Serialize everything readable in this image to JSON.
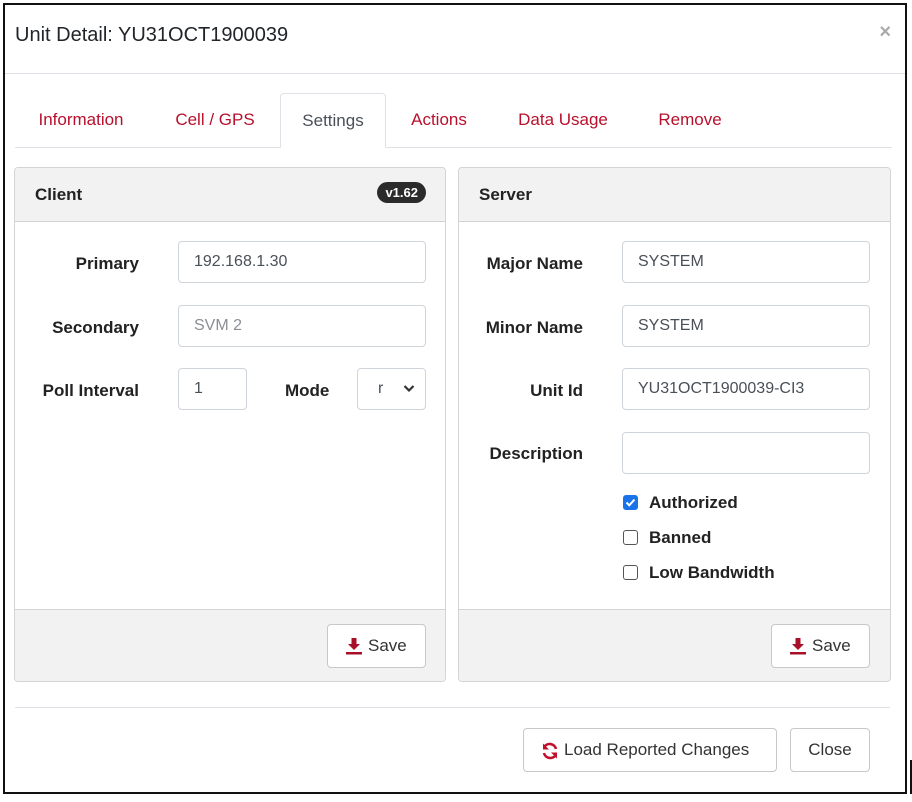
{
  "modal": {
    "title": "Unit Detail: YU31OCT1900039",
    "close_symbol": "×"
  },
  "tabs": [
    {
      "label": "Information",
      "active": false
    },
    {
      "label": "Cell / GPS",
      "active": false
    },
    {
      "label": "Settings",
      "active": true
    },
    {
      "label": "Actions",
      "active": false
    },
    {
      "label": "Data Usage",
      "active": false
    },
    {
      "label": "Remove",
      "active": false
    }
  ],
  "client": {
    "title": "Client",
    "version_badge": "v1.62",
    "primary_label": "Primary",
    "primary_value": "192.168.1.30",
    "secondary_label": "Secondary",
    "secondary_placeholder": "SVM 2",
    "poll_label": "Poll Interval",
    "poll_value": "1",
    "mode_label": "Mode",
    "mode_value": "r",
    "save_label": "Save"
  },
  "server": {
    "title": "Server",
    "major_label": "Major Name",
    "major_value": "SYSTEM",
    "minor_label": "Minor Name",
    "minor_value": "SYSTEM",
    "unit_id_label": "Unit Id",
    "unit_id_value": "YU31OCT1900039-CI3",
    "description_label": "Description",
    "description_value": "",
    "checkboxes": [
      {
        "label": "Authorized",
        "checked": true
      },
      {
        "label": "Banned",
        "checked": false
      },
      {
        "label": "Low Bandwidth",
        "checked": false
      }
    ],
    "save_label": "Save"
  },
  "footer": {
    "load_label": "Load Reported Changes",
    "close_label": "Close"
  },
  "colors": {
    "tab_link": "#b8102c",
    "save_icon": "#a8102a",
    "load_icon": "#c0102c",
    "checkbox_on": "#1a73e8"
  },
  "icons": {
    "save": "download-icon",
    "load": "refresh-icon",
    "close": "close-icon",
    "select": "chevron-down-icon"
  }
}
